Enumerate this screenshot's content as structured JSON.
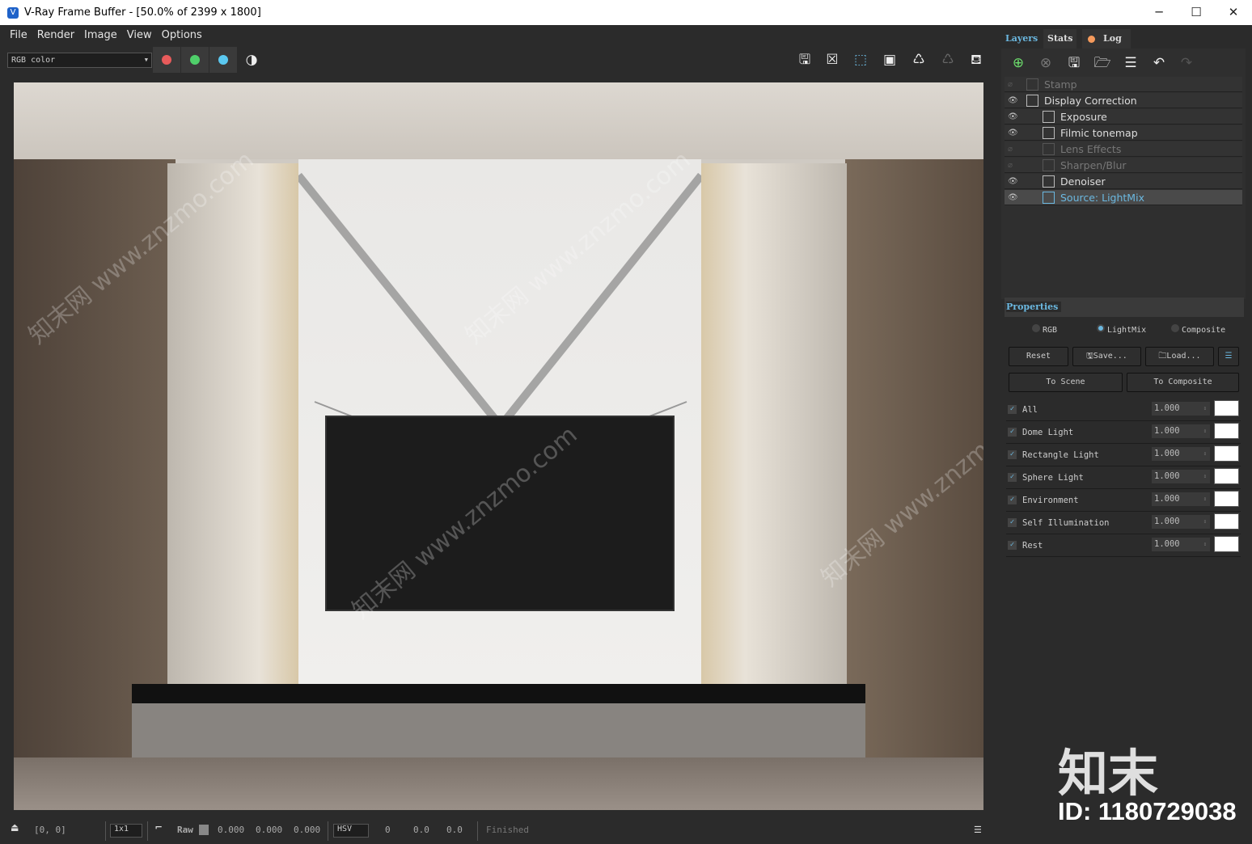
{
  "window": {
    "title": "V-Ray Frame Buffer - [50.0% of 2399 x 1800]",
    "minimize": "─",
    "maximize": "☐",
    "close": "✕"
  },
  "menu": [
    "File",
    "Render",
    "Image",
    "View",
    "Options"
  ],
  "toolbar": {
    "channel_select": "RGB color",
    "channel_colors": {
      "red": "#e85b5b",
      "green": "#4fcf6a",
      "blue": "#5bc8f0"
    }
  },
  "status": {
    "coords": "[0, 0]",
    "zoom_select": "1x1",
    "raw_label": "Raw",
    "rgb": [
      "0.000",
      "0.000",
      "0.000"
    ],
    "color_mode": "HSV",
    "hsv": [
      "0",
      "0.0",
      "0.0"
    ],
    "state": "Finished"
  },
  "tabs": {
    "layers": "Layers",
    "stats": "Stats",
    "log": "Log"
  },
  "layers": [
    {
      "label": "Stamp",
      "visible": false
    },
    {
      "label": "Display Correction",
      "visible": true
    },
    {
      "label": "Exposure",
      "visible": true
    },
    {
      "label": "Filmic tonemap",
      "visible": true
    },
    {
      "label": "Lens Effects",
      "visible": false
    },
    {
      "label": "Sharpen/Blur",
      "visible": false
    },
    {
      "label": "Denoiser",
      "visible": true
    },
    {
      "label": "Source: LightMix",
      "visible": true,
      "selected": true
    }
  ],
  "properties": {
    "title": "Properties",
    "modes": [
      "RGB",
      "LightMix",
      "Composite"
    ],
    "selected_mode": "LightMix",
    "reset": "Reset",
    "save": "Save...",
    "load": "Load...",
    "to_scene": "To Scene",
    "to_composite": "To Composite",
    "lights": [
      {
        "name": "All",
        "value": "1.000",
        "checked": true
      },
      {
        "name": "Dome Light",
        "value": "1.000",
        "checked": true
      },
      {
        "name": "Rectangle Light",
        "value": "1.000",
        "checked": true
      },
      {
        "name": "Sphere Light",
        "value": "1.000",
        "checked": true
      },
      {
        "name": "Environment",
        "value": "1.000",
        "checked": true
      },
      {
        "name": "Self Illumination",
        "value": "1.000",
        "checked": true
      },
      {
        "name": "Rest",
        "value": "1.000",
        "checked": true
      }
    ]
  },
  "watermark": {
    "logo": "知末",
    "id": "ID: 1180729038",
    "site": "知末网 www.znzmo.com"
  }
}
